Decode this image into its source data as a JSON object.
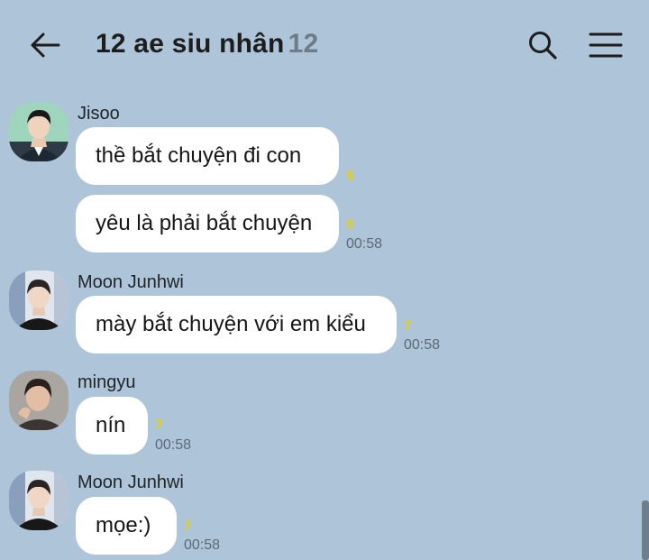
{
  "header": {
    "title": "12 ae siu nhân",
    "member_count": "12",
    "icons": {
      "back": "arrow-left-icon",
      "search": "search-icon",
      "menu": "hamburger-menu-icon"
    }
  },
  "messages": [
    {
      "sender": "Jisoo",
      "text": "thề bắt chuyện đi con",
      "unread": "5",
      "time": ""
    },
    {
      "sender": "",
      "text": "yêu là phải bắt chuyện",
      "unread": "5",
      "time": "00:58"
    },
    {
      "sender": "Moon Junhwi",
      "text": "mày bắt chuyện với em kiểu",
      "unread": "7",
      "time": "00:58"
    },
    {
      "sender": "mingyu",
      "text": "nín",
      "unread": "7",
      "time": "00:58"
    },
    {
      "sender": "Moon Junhwi",
      "text": "mọe:)",
      "unread": "7",
      "time": "00:58"
    }
  ],
  "colors": {
    "background": "#aec4d9",
    "bubble": "#ffffff",
    "unread": "#e7d200",
    "time": "#5c6a77"
  }
}
